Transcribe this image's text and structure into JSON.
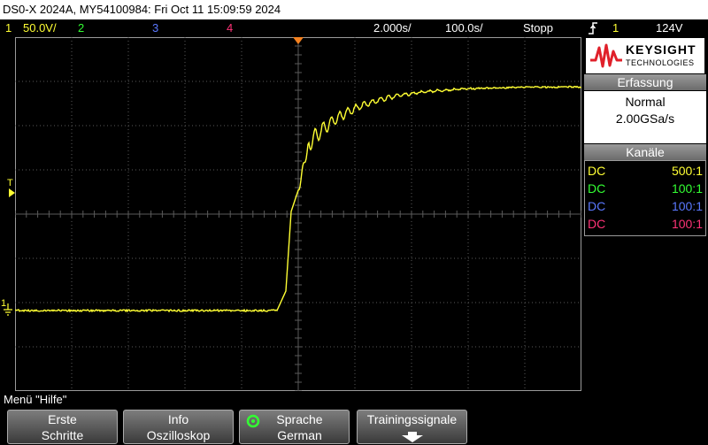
{
  "title_bar": {
    "text": "DS0-X 2024A, MY54100984: Fri Oct 11 15:09:59 2024"
  },
  "status_bar": {
    "ch1_num": "1",
    "ch1_scale": "50.0V/",
    "ch2_num": "2",
    "ch3_num": "3",
    "ch4_num": "4",
    "timebase": "2.000s/",
    "delay": "100.0s/",
    "run_state": "Stopp",
    "trigger_icon": "trigger-edge-icon",
    "trigger_source": "1",
    "trigger_level": "124V"
  },
  "screen": {
    "trigger_level_label": "T",
    "ch1_ground_label": "1"
  },
  "brand": {
    "name": "KEYSIGHT",
    "sub": "TECHNOLOGIES"
  },
  "acquisition": {
    "header": "Erfassung",
    "mode": "Normal",
    "rate": "2.00GSa/s"
  },
  "channels": {
    "header": "Kanäle",
    "rows": [
      {
        "coupling": "DC",
        "atten": "500:1",
        "color": "#ffff33"
      },
      {
        "coupling": "DC",
        "atten": "100:1",
        "color": "#33ff33"
      },
      {
        "coupling": "DC",
        "atten": "100:1",
        "color": "#5a78ff"
      },
      {
        "coupling": "DC",
        "atten": "100:1",
        "color": "#ff3377"
      }
    ]
  },
  "menu": {
    "title": "Menü \"Hilfe\"",
    "softkeys": [
      {
        "line1": "Erste",
        "line2": "Schritte"
      },
      {
        "line1": "Info",
        "line2": "Oszilloskop"
      },
      {
        "line1": "Sprache",
        "line2": "German"
      },
      {
        "line1": "Trainingssignale",
        "line2": ""
      }
    ]
  },
  "colors": {
    "ch1": "#ffff33",
    "ch2": "#33ff33",
    "ch3": "#5a78ff",
    "ch4": "#ff3377",
    "trigger": "#f58220",
    "grid": "#5a5a5a"
  }
}
